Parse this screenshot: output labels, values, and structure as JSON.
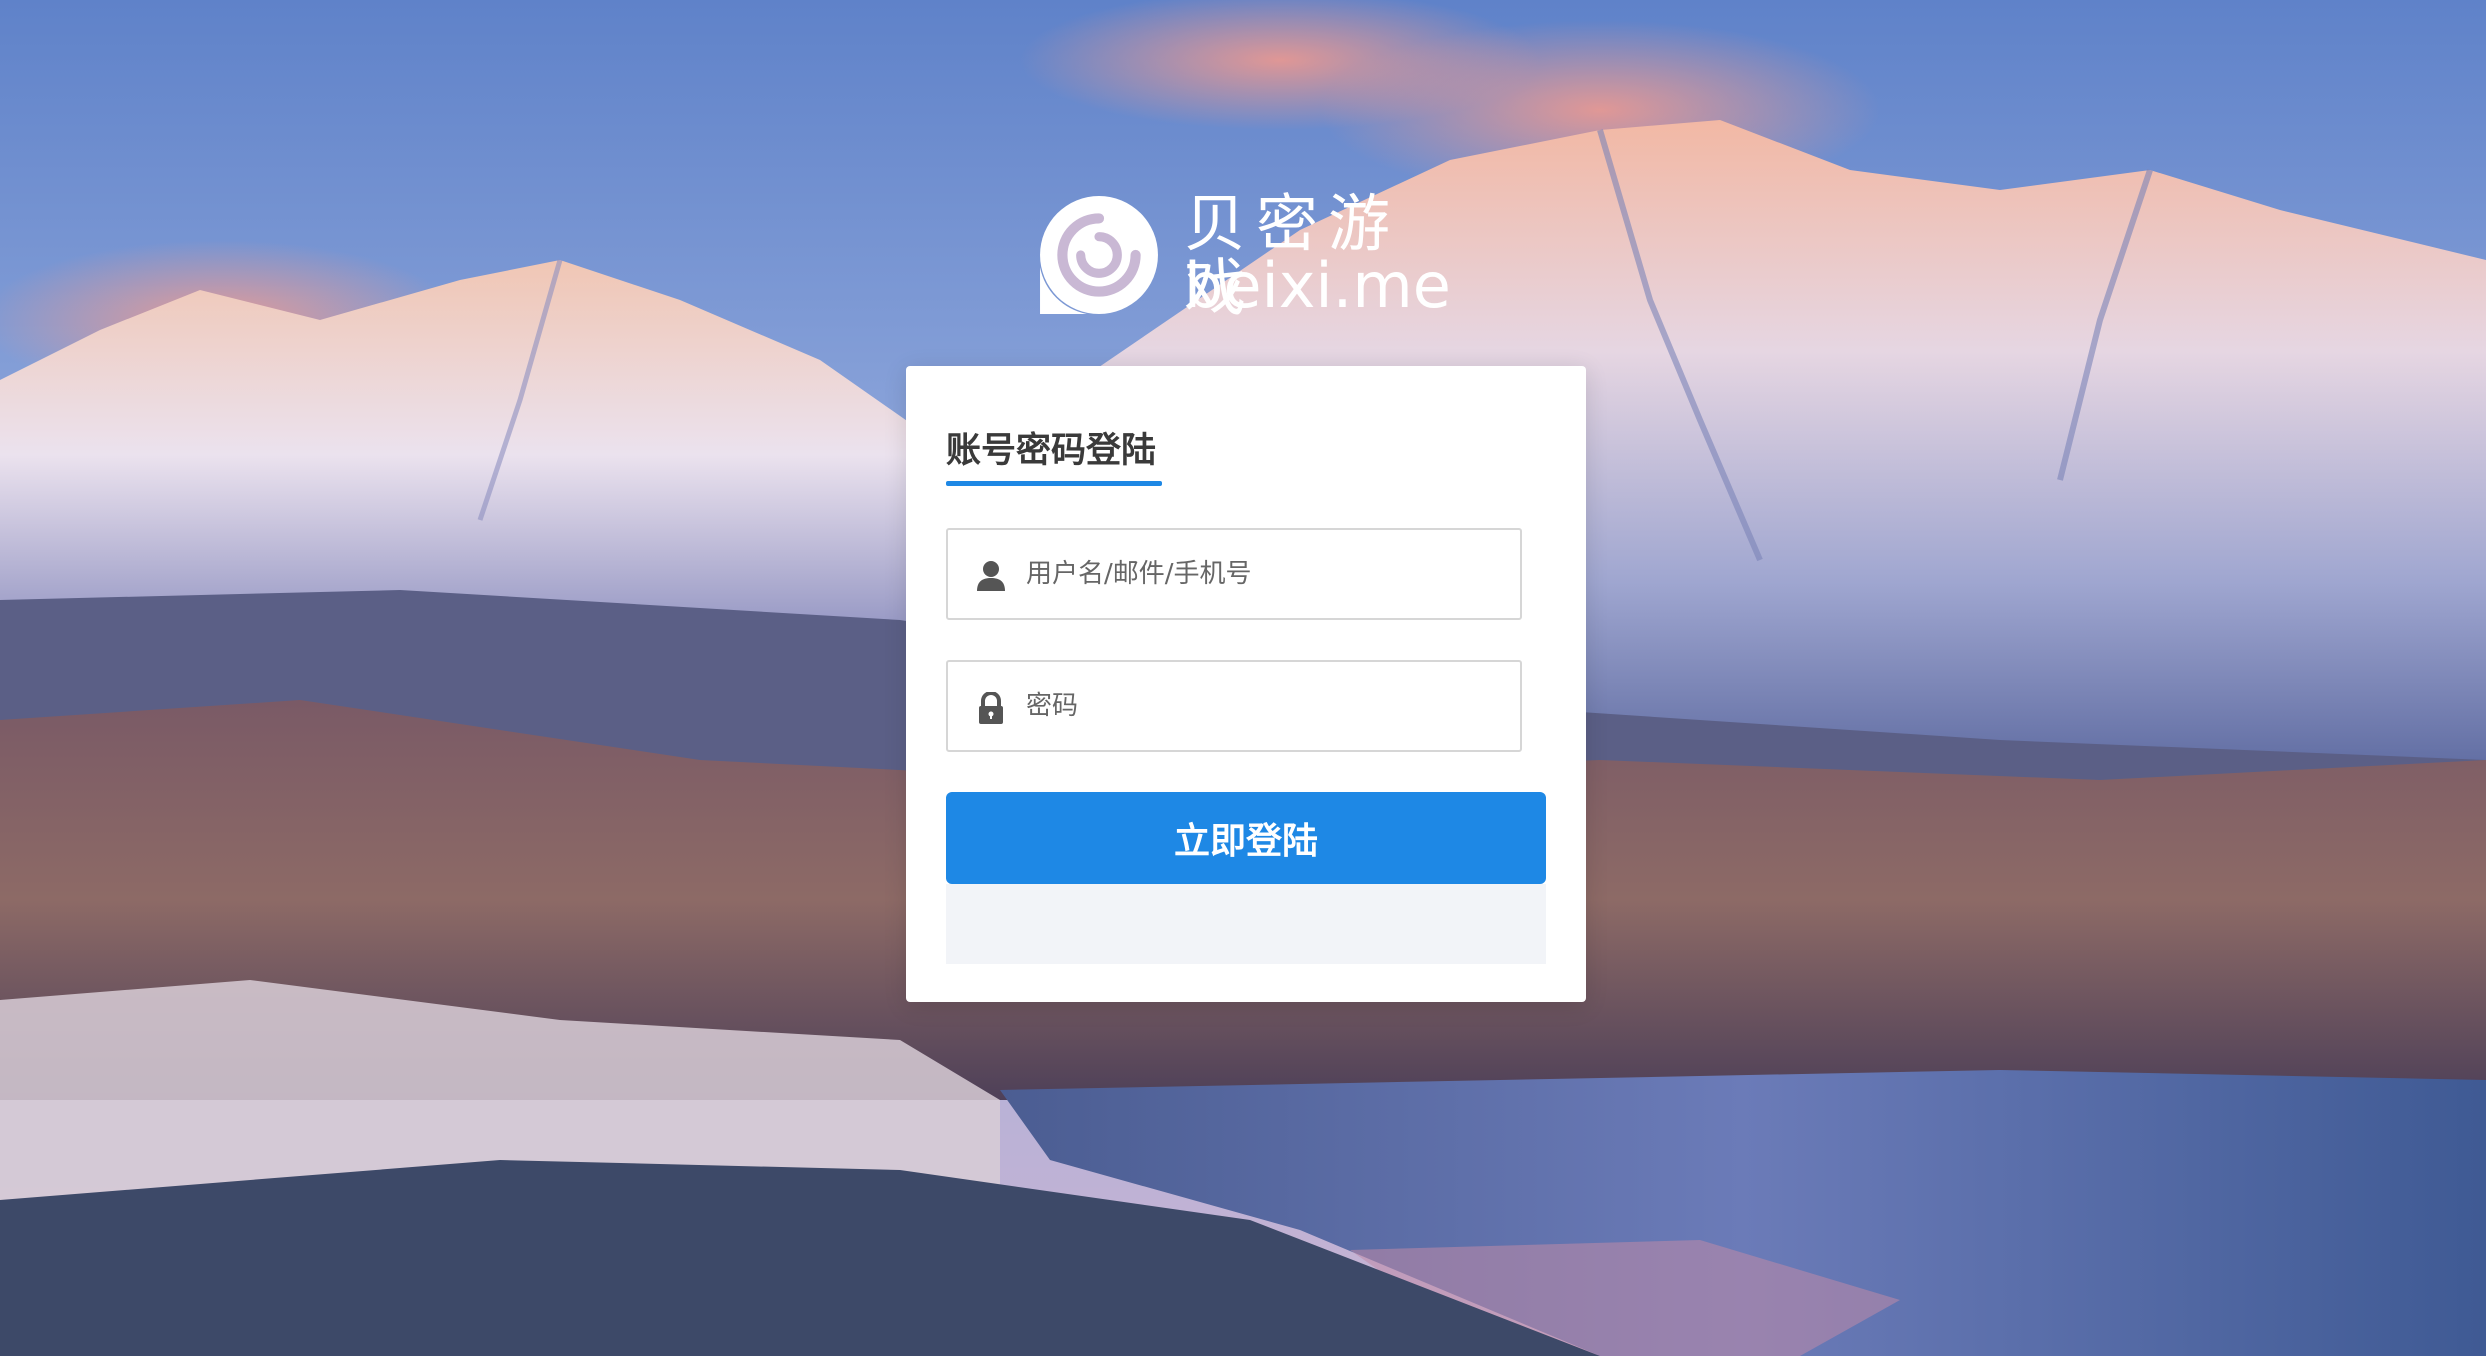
{
  "brand": {
    "name_cn": "贝密游戏",
    "domain": "beixi.me",
    "logo_icon": "beixi-logo-icon"
  },
  "login_card": {
    "title": "账号密码登陆",
    "username": {
      "placeholder": "用户名/邮件/手机号",
      "value": "",
      "icon": "user-icon"
    },
    "password": {
      "placeholder": "密码",
      "value": "",
      "icon": "lock-icon"
    },
    "submit_label": "立即登陆"
  },
  "colors": {
    "accent": "#1e88e5",
    "card_bg": "#ffffff",
    "footer_bg": "#f2f4f8",
    "title_text": "#3a3a3a"
  }
}
